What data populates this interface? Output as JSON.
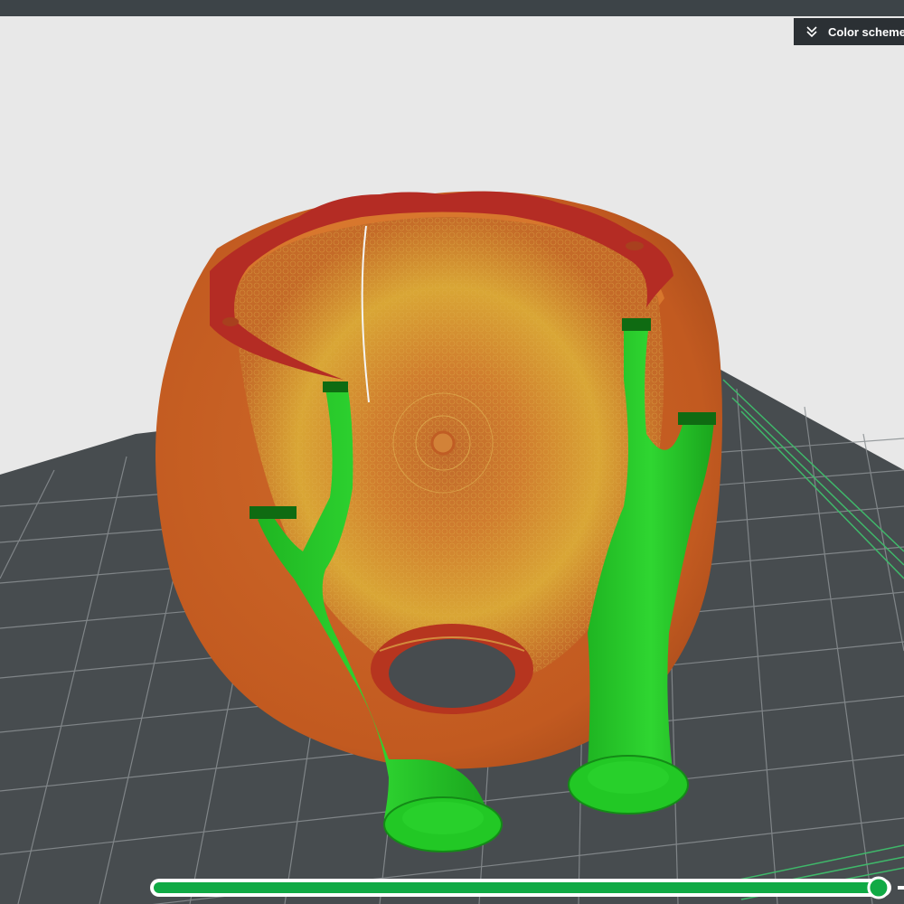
{
  "toolbar": {
    "color_scheme_label": "Color scheme"
  },
  "icons": {
    "color_scheme_toggle": "double-chevron-down-icon"
  },
  "layer_slider": {
    "progress": 0.99
  },
  "colors": {
    "top_bar": "#3d4448",
    "background": "#e8e8e8",
    "build_plate": "#474c4f",
    "grid_line": "#8a8f92",
    "model_wall": "#c45e22",
    "model_top": "#b42c24",
    "infill_gradient": "#d9a635",
    "support": "#22c825",
    "slider_fill": "#10aa45",
    "button_bg": "#2b3034"
  }
}
